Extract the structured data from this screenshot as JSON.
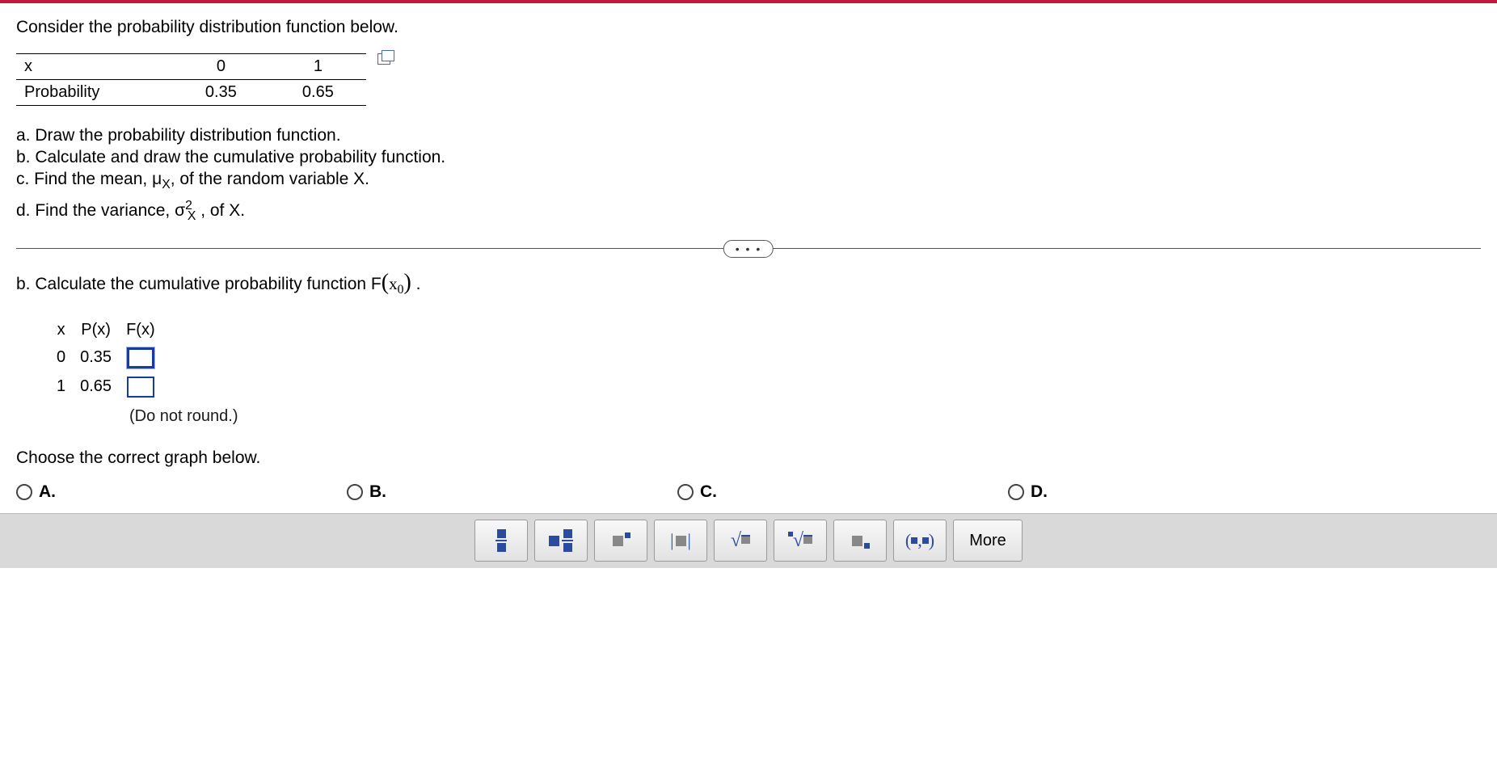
{
  "question": {
    "prompt": "Consider the probability distribution function below.",
    "table": {
      "row1": {
        "label": "x",
        "c0": "0",
        "c1": "1"
      },
      "row2": {
        "label": "Probability",
        "c0": "0.35",
        "c1": "0.65"
      }
    },
    "parts": {
      "a": "a. Draw the probability distribution function.",
      "b": "b. Calculate and draw the cumulative probability function.",
      "c_pre": "c. Find the mean, μ",
      "c_sub": "X",
      "c_post": ", of the random variable X.",
      "d_pre": "d. Find the variance, σ",
      "d_sub": "X",
      "d_sup": "2",
      "d_post": " , of X."
    }
  },
  "section_b": {
    "label_pre": "b. Calculate the cumulative probability function F",
    "label_arg": "x",
    "label_sub": "0",
    "label_post": " .",
    "headers": {
      "x": "x",
      "px": "P(x)",
      "fx": "F(x)"
    },
    "rows": [
      {
        "x": "0",
        "px": "0.35",
        "fx": ""
      },
      {
        "x": "1",
        "px": "0.65",
        "fx": ""
      }
    ],
    "no_round": "(Do not round.)"
  },
  "choose": {
    "label": "Choose the correct graph below.",
    "options": {
      "a": "A.",
      "b": "B.",
      "c": "C.",
      "d": "D."
    }
  },
  "divider": {
    "dots": "• • •"
  },
  "toolbar": {
    "more": "More",
    "ordered_pair": "(▪,▪)"
  }
}
